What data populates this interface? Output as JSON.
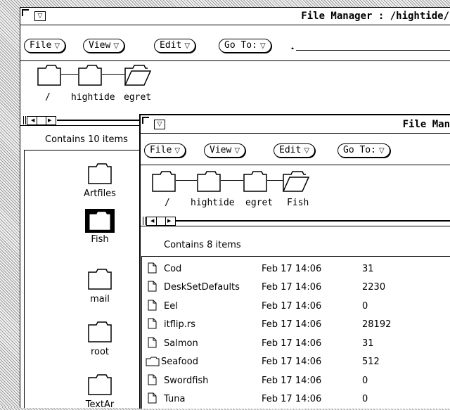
{
  "back_window": {
    "title": "File Manager : /hightide/",
    "menus": [
      "File",
      "View",
      "Edit",
      "Go To:"
    ],
    "path": [
      "/",
      "hightide",
      "egret"
    ],
    "status": "Contains 10 items",
    "icons": [
      "Artfiles",
      "Fish",
      "mail",
      "root",
      "TextAr"
    ],
    "selected_icon": "Fish"
  },
  "front_window": {
    "title": "File Man",
    "menus": [
      "File",
      "View",
      "Edit",
      "Go To:"
    ],
    "path": [
      "/",
      "hightide",
      "egret",
      "Fish"
    ],
    "status": "Contains 8 items",
    "files": [
      {
        "name": "Cod",
        "type": "file",
        "date": "Feb 17 14:06",
        "size": "31"
      },
      {
        "name": "DeskSetDefaults",
        "type": "file",
        "date": "Feb 17 14:06",
        "size": "2230"
      },
      {
        "name": "Eel",
        "type": "file",
        "date": "Feb 17 14:06",
        "size": "0"
      },
      {
        "name": "itflip.rs",
        "type": "file",
        "date": "Feb 17 14:06",
        "size": "28192"
      },
      {
        "name": "Salmon",
        "type": "file",
        "date": "Feb 17 14:06",
        "size": "31"
      },
      {
        "name": "Seafood",
        "type": "folder",
        "date": "Feb 17 14:06",
        "size": "512"
      },
      {
        "name": "Swordfish",
        "type": "file",
        "date": "Feb 17 14:06",
        "size": "0"
      },
      {
        "name": "Tuna",
        "type": "file",
        "date": "Feb 17 14:06",
        "size": "0"
      }
    ]
  },
  "glyphs": {
    "menu_arrow": "▽",
    "scroll_left": "◀",
    "scroll_right": "▶"
  },
  "icons_used": [
    "window-menu-icon",
    "folder-icon",
    "open-folder-icon",
    "document-icon",
    "chevron-down-icon"
  ]
}
